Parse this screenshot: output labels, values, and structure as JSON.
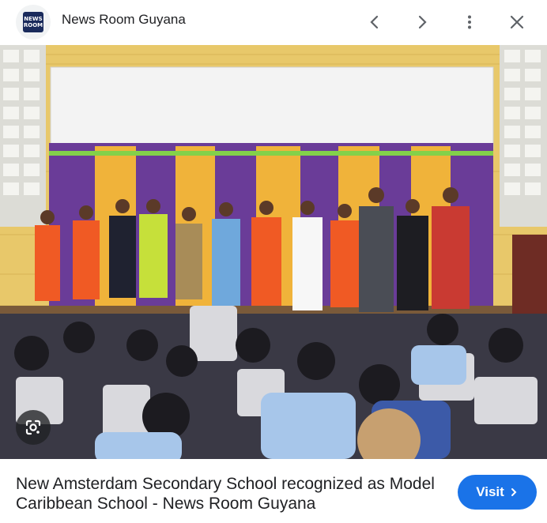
{
  "header": {
    "logo_text_top": "NEWS",
    "logo_text_bottom": "ROOM",
    "site_name": "News Room Guyana"
  },
  "icons": {
    "back": "chevron-left-icon",
    "forward": "chevron-right-icon",
    "more": "more-vert-icon",
    "close": "close-icon",
    "lens": "google-lens-icon"
  },
  "caption": {
    "title": "New Amsterdam Secondary School recognized as Model Caribbean School - News Room Guyana"
  },
  "visit_button": {
    "label": "Visit",
    "color": "#1a73e8"
  }
}
